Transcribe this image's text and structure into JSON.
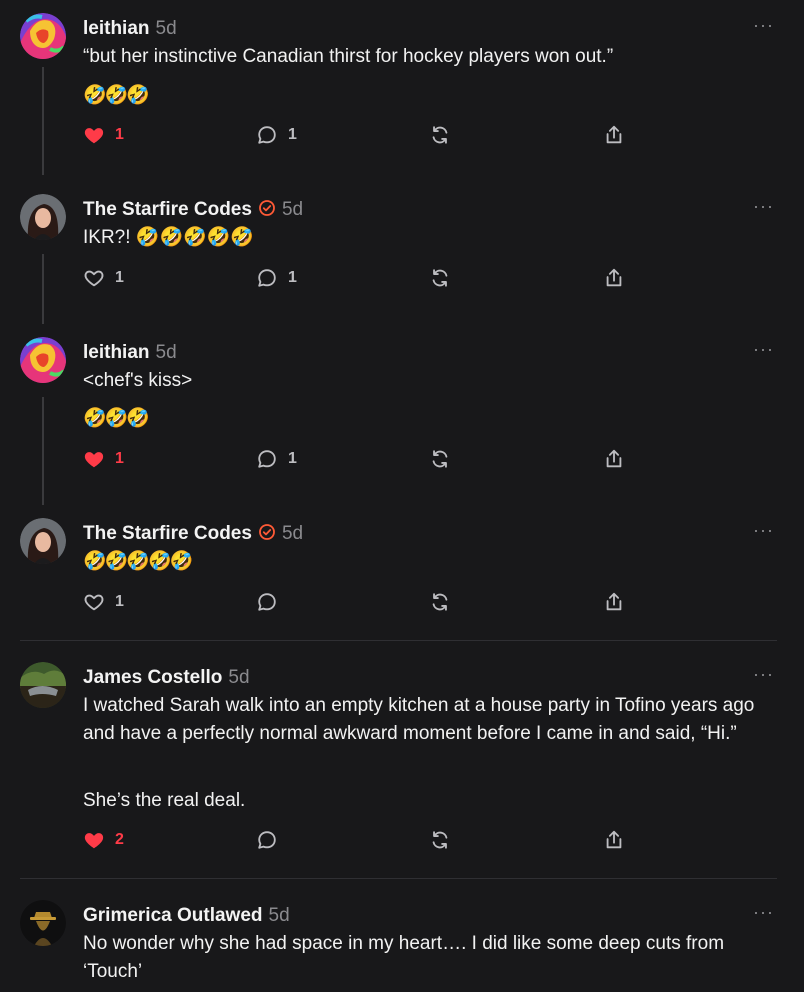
{
  "posts": [
    {
      "id": "p1",
      "author": "leithian",
      "time": "5d",
      "verified": false,
      "avatar": "leithian-avatar",
      "lines": [
        "“but her instinctive Canadian thirst for hockey players won out.”"
      ],
      "emoji": "🤣🤣🤣",
      "likes": "1",
      "liked": true,
      "replies": "1",
      "more": "···"
    },
    {
      "id": "p2",
      "author": "The Starfire Codes",
      "time": "5d",
      "verified": true,
      "avatar": "starfire-avatar",
      "lines": [
        "IKR?! 🤣🤣🤣🤣🤣"
      ],
      "emoji": "",
      "likes": "1",
      "liked": false,
      "replies": "1",
      "more": "···"
    },
    {
      "id": "p3",
      "author": "leithian",
      "time": "5d",
      "verified": false,
      "avatar": "leithian-avatar",
      "lines": [
        "<chef's kiss>"
      ],
      "emoji": "🤣🤣🤣",
      "likes": "1",
      "liked": true,
      "replies": "1",
      "more": "···"
    },
    {
      "id": "p4",
      "author": "The Starfire Codes",
      "time": "5d",
      "verified": true,
      "avatar": "starfire-avatar",
      "lines": [],
      "emoji": "🤣🤣🤣🤣🤣",
      "likes": "1",
      "liked": false,
      "replies": "",
      "more": "···"
    },
    {
      "id": "p5",
      "author": "James Costello",
      "time": "5d",
      "verified": false,
      "avatar": "james-avatar",
      "lines": [
        "I watched Sarah walk into an empty kitchen at a house party in Tofino years ago and have a perfectly normal awkward moment before I came in and said, “Hi.”",
        "She’s the real deal."
      ],
      "emoji": "",
      "likes": "2",
      "liked": true,
      "replies": "",
      "more": "···"
    },
    {
      "id": "p6",
      "author": "Grimerica Outlawed",
      "time": "5d",
      "verified": false,
      "avatar": "grimerica-avatar",
      "lines": [
        "No wonder why she had space in my heart…. I did like some deep cuts from ‘Touch’"
      ],
      "emoji": "",
      "more": "···"
    }
  ],
  "colors": {
    "background": "#18181a",
    "liked": "#ff3b48",
    "muted": "#8a8a8e",
    "verified": "#ff5a36"
  }
}
